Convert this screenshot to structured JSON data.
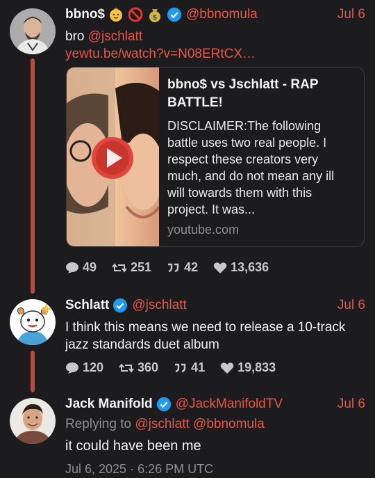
{
  "tweets": [
    {
      "name": "bbno$",
      "handle": "@bbnomula",
      "date": "Jul 6",
      "text_prefix": "bro ",
      "mention": "@jschlatt",
      "link": "yewtu.be/watch?v=N08ERtCX…",
      "card": {
        "title": "bbno$ vs Jschlatt - RAP BATTLE!",
        "description": "DISCLAIMER:The following battle uses two real people. I respect these creators very much, and do not mean any ill will towards them with this project. It was...",
        "domain": "youtube.com"
      },
      "stats": {
        "replies": "49",
        "retweets": "251",
        "quotes": "42",
        "likes": "13,636"
      }
    },
    {
      "name": "Schlatt",
      "handle": "@jschlatt",
      "date": "Jul 6",
      "text": "I think this means we need to release a 10-track jazz standards duet album",
      "stats": {
        "replies": "120",
        "retweets": "360",
        "quotes": "41",
        "likes": "19,833"
      }
    },
    {
      "name": "Jack Manifold",
      "handle": "@JackManifoldTV",
      "date": "Jul 6",
      "replying_label": "Replying to ",
      "replying_to": "@jschlatt @bbnomula",
      "text": "it could have been me",
      "timestamp": "Jul 6, 2025 · 6:26 PM UTC"
    }
  ],
  "colors": {
    "accent": "#e8564a",
    "background": "#1c1c1e",
    "verified": "#1d9bf0",
    "thread": "#b94a40"
  },
  "icons": [
    "baby-emoji",
    "prohibited-emoji",
    "money-bag-emoji",
    "verified-icon",
    "reply-icon",
    "retweet-icon",
    "quote-icon",
    "heart-icon",
    "play-icon"
  ]
}
